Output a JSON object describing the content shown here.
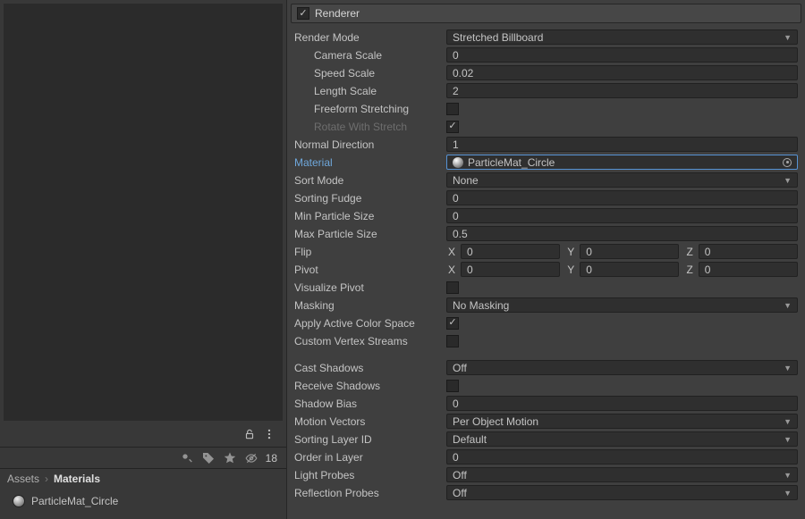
{
  "leftPane": {
    "hiddenCount": "18",
    "breadcrumb": {
      "root": "Assets",
      "folder": "Materials"
    },
    "assetName": "ParticleMat_Circle"
  },
  "renderer": {
    "enabled": true,
    "title": "Renderer",
    "renderMode": {
      "label": "Render Mode",
      "value": "Stretched Billboard"
    },
    "cameraScale": {
      "label": "Camera Scale",
      "value": "0"
    },
    "speedScale": {
      "label": "Speed Scale",
      "value": "0.02"
    },
    "lengthScale": {
      "label": "Length Scale",
      "value": "2"
    },
    "freeformStretching": {
      "label": "Freeform Stretching",
      "value": false
    },
    "rotateWithStretch": {
      "label": "Rotate With Stretch",
      "value": true
    },
    "normalDirection": {
      "label": "Normal Direction",
      "value": "1"
    },
    "material": {
      "label": "Material",
      "value": "ParticleMat_Circle"
    },
    "sortMode": {
      "label": "Sort Mode",
      "value": "None"
    },
    "sortingFudge": {
      "label": "Sorting Fudge",
      "value": "0"
    },
    "minParticleSize": {
      "label": "Min Particle Size",
      "value": "0"
    },
    "maxParticleSize": {
      "label": "Max Particle Size",
      "value": "0.5"
    },
    "flip": {
      "label": "Flip",
      "x": "0",
      "y": "0",
      "z": "0"
    },
    "pivot": {
      "label": "Pivot",
      "x": "0",
      "y": "0",
      "z": "0"
    },
    "visualizePivot": {
      "label": "Visualize Pivot",
      "value": false
    },
    "masking": {
      "label": "Masking",
      "value": "No Masking"
    },
    "applyActiveColorSpace": {
      "label": "Apply Active Color Space",
      "value": true
    },
    "customVertexStreams": {
      "label": "Custom Vertex Streams",
      "value": false
    },
    "castShadows": {
      "label": "Cast Shadows",
      "value": "Off"
    },
    "receiveShadows": {
      "label": "Receive Shadows",
      "value": false
    },
    "shadowBias": {
      "label": "Shadow Bias",
      "value": "0"
    },
    "motionVectors": {
      "label": "Motion Vectors",
      "value": "Per Object Motion"
    },
    "sortingLayerID": {
      "label": "Sorting Layer ID",
      "value": "Default"
    },
    "orderInLayer": {
      "label": "Order in Layer",
      "value": "0"
    },
    "lightProbes": {
      "label": "Light Probes",
      "value": "Off"
    },
    "reflectionProbes": {
      "label": "Reflection Probes",
      "value": "Off"
    }
  },
  "axes": {
    "x": "X",
    "y": "Y",
    "z": "Z"
  }
}
